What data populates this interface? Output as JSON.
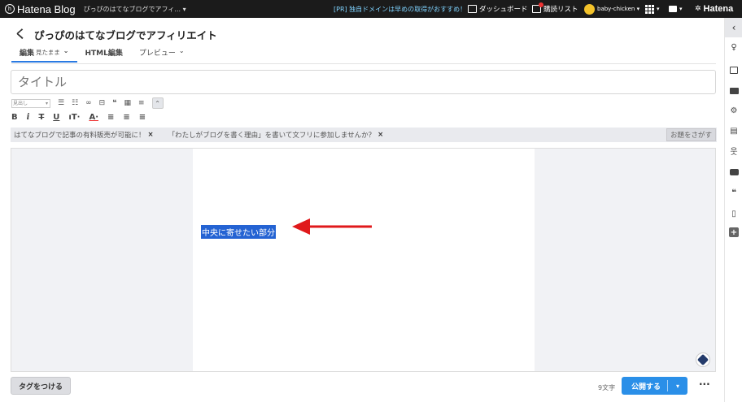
{
  "topbar": {
    "logo_text": "Hatena Blog",
    "blog_selector": "ぴっぴのはてなブログでアフィ... ▾",
    "pr_text": "[PR] 独自ドメインは早めの取得がおすすめ！",
    "dashboard": "ダッシュボード",
    "reading_list": "購読リスト",
    "user": "baby-chicken ▾",
    "hatena": "Hatena"
  },
  "header": {
    "back": "く",
    "title": "ぴっぴのはてなブログでアフィリエイト"
  },
  "tabs": [
    {
      "label": "編集",
      "sub": "見たまま"
    },
    {
      "label": "HTML編集",
      "sub": ""
    },
    {
      "label": "プレビュー",
      "sub": ""
    }
  ],
  "editor": {
    "title_placeholder": "タイトル",
    "heading_select": "見出し",
    "selected_text": "中央に寄せたい部分",
    "arrow_color": "#e0191b",
    "selection_color": "#2463d3"
  },
  "notices": {
    "item1": "はてなブログで記事の有料販売が可能に！",
    "item2": "「わたしがブログを書く理由」を書いて文フリに参加しませんか？",
    "close": "×",
    "odai_button": "お題をさがす"
  },
  "footer": {
    "tag_button": "タグをつける",
    "char_count": "9文字",
    "publish": "公開する",
    "publish_dropdown": "▾",
    "more": "···"
  },
  "colors": {
    "accent": "#2a8fe8",
    "topbar": "#1b1b1b"
  }
}
